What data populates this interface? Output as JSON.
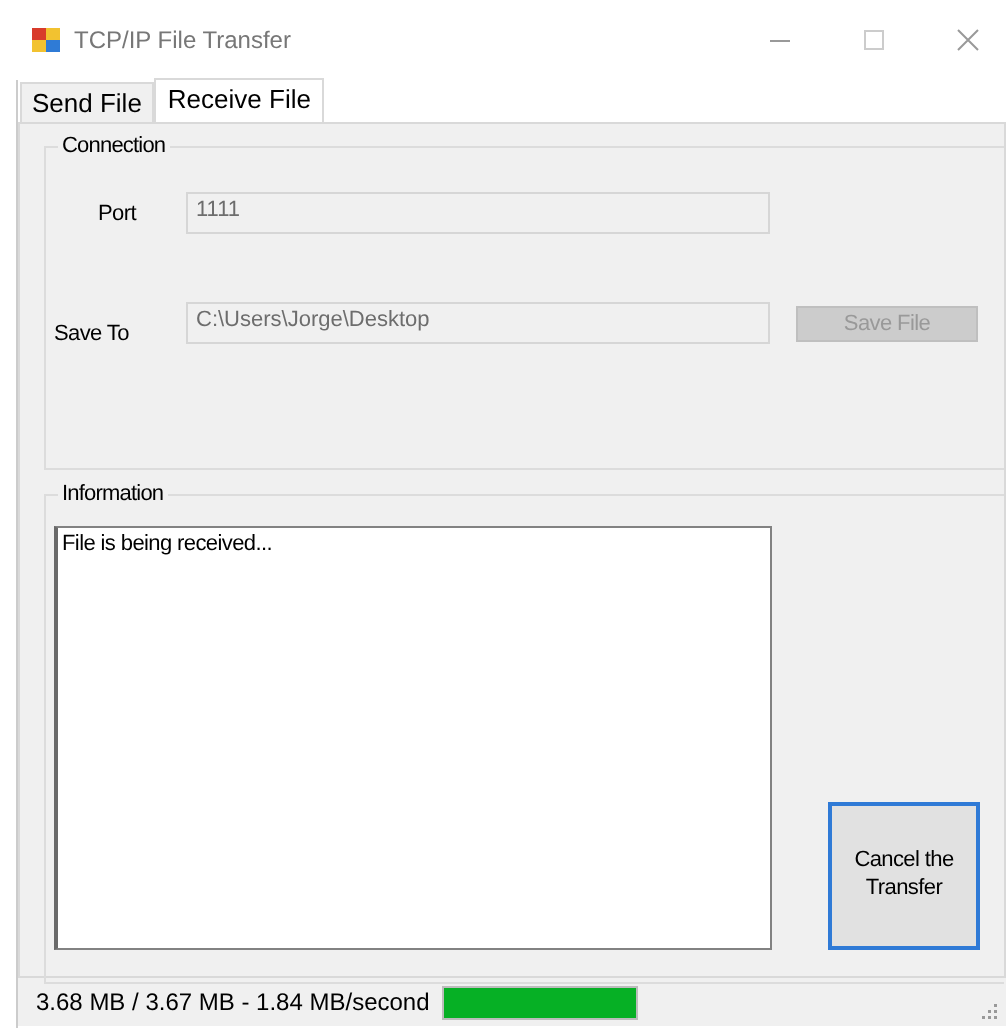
{
  "window": {
    "title": "TCP/IP File Transfer"
  },
  "tabs": [
    {
      "label": "Send File",
      "selected": false
    },
    {
      "label": "Receive File",
      "selected": true
    }
  ],
  "connection": {
    "title": "Connection",
    "port": {
      "label": "Port",
      "value": "1111",
      "disabled": true
    },
    "save_to": {
      "label": "Save To",
      "value": "C:\\Users\\Jorge\\Desktop",
      "disabled": true
    },
    "save_button": {
      "label": "Save File",
      "disabled": true
    }
  },
  "information": {
    "title": "Information",
    "log": "File is being received...",
    "cancel_button": {
      "label": "Cancel the Transfer",
      "focused": true
    }
  },
  "status_bar": {
    "text": "3.68 MB / 3.67 MB - 1.84 MB/second",
    "progress": {
      "level": 1
    }
  }
}
